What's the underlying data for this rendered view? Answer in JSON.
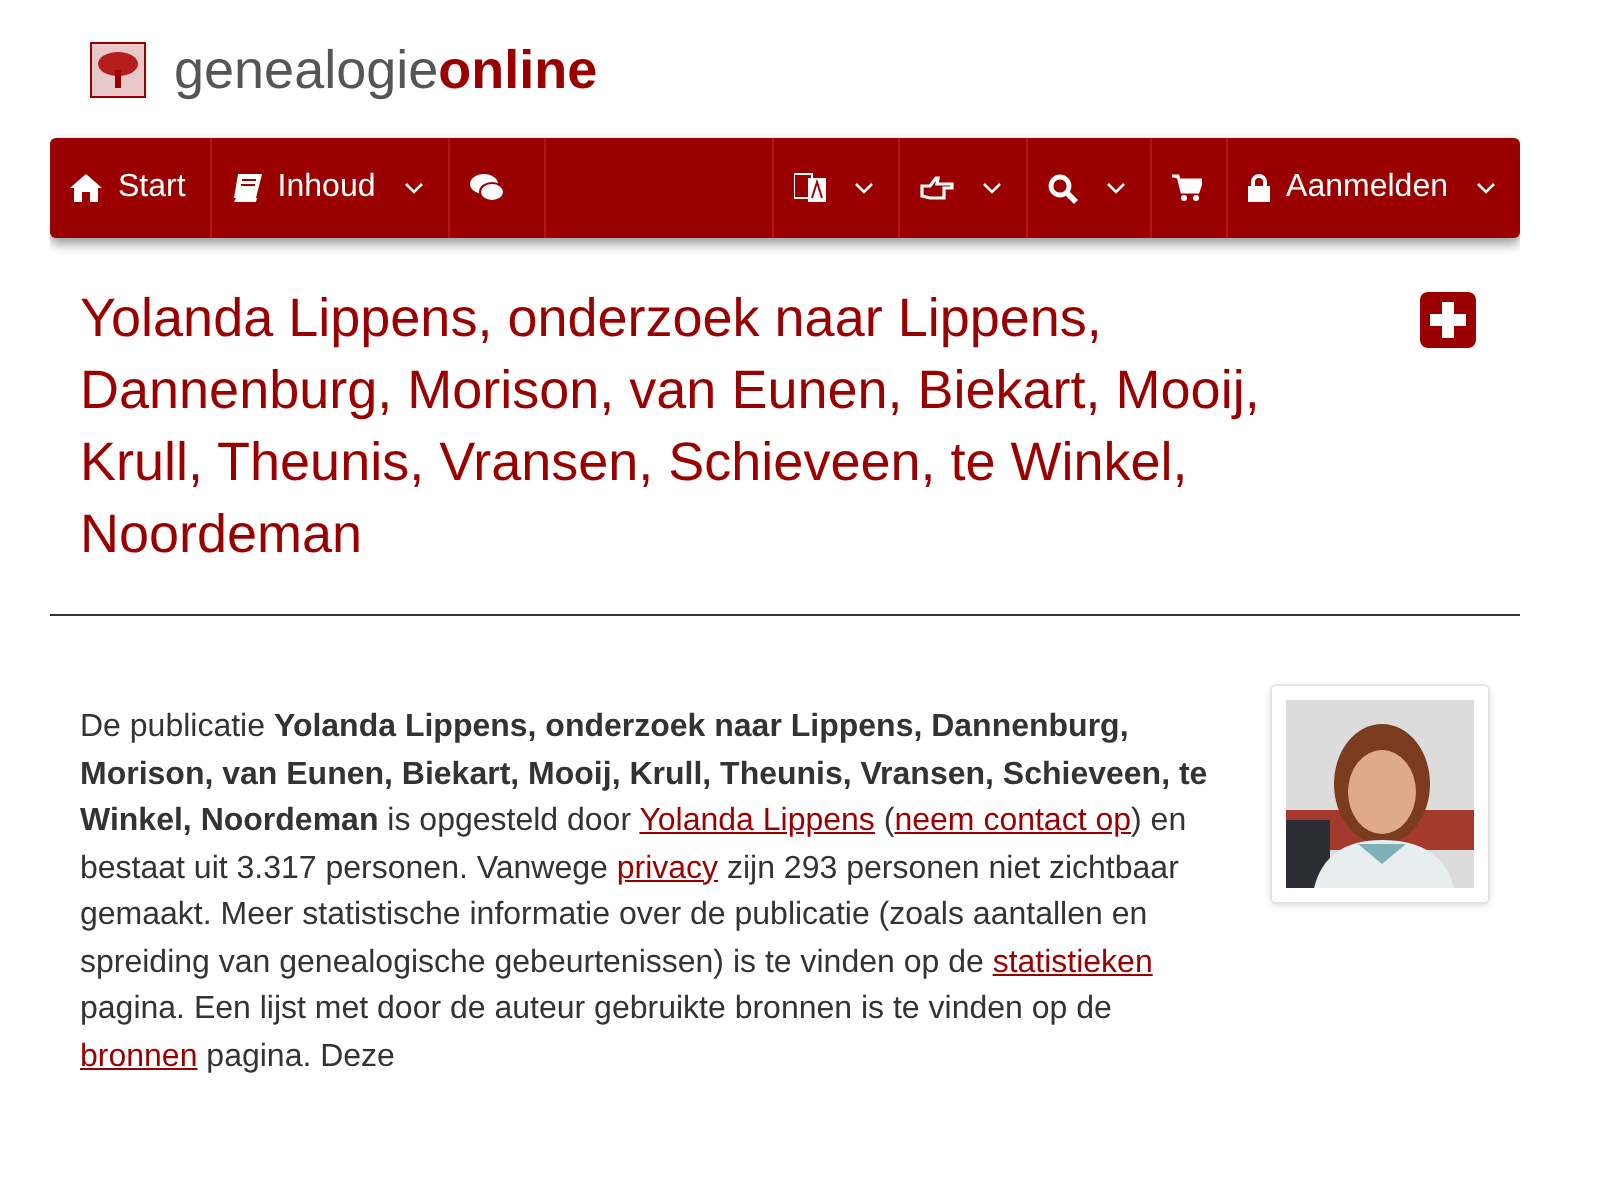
{
  "logo": {
    "name_part": "genealogie",
    "accent_part": "online"
  },
  "nav": {
    "left_items": [
      {
        "label": "Start",
        "dropdown": false
      },
      {
        "label": "Inhoud",
        "dropdown": true
      },
      {
        "dropdown": false
      }
    ],
    "right_items": [
      {
        "dropdown": true
      },
      {
        "dropdown": true
      },
      {
        "dropdown": true
      },
      {
        "dropdown": false
      },
      {
        "label": "Aanmelden",
        "dropdown": true
      }
    ]
  },
  "title": "Yolanda Lippens, onderzoek naar Lippens, Dannenburg, Morison, van Eunen, Biekart, Mooij, Krull, Theunis, Vransen, Schieveen, te Winkel, Noordeman",
  "intro": {
    "segments": [
      {
        "kind": "text",
        "text": "De publicatie **Yolanda Lippens, onderzoek naar Lippens, Dannenburg, Morison, van Eunen, Biekart, Mooij, Krull, Theunis, Vransen, Schieveen, te Winkel, Noordeman** is opgesteld door "
      },
      {
        "kind": "link",
        "text": "Yolanda Lippens"
      },
      {
        "kind": "text",
        "text": " ("
      },
      {
        "kind": "link",
        "text": "neem contact op"
      },
      {
        "kind": "text",
        "text": ") en bestaat uit 3.317 personen. Vanwege "
      },
      {
        "kind": "link",
        "text": "privacy"
      },
      {
        "kind": "text",
        "text": " zijn 293 personen niet zichtbaar gemaakt. Meer statistische informatie over de publicatie (zoals aantallen en spreiding van genealogische gebeurtenissen) is te vinden op de "
      },
      {
        "kind": "link",
        "text": "statistieken"
      },
      {
        "kind": "text",
        "text": " pagina. Een lijst met door de auteur gebruikte bronnen is te vinden op de "
      },
      {
        "kind": "link",
        "text": "bronnen"
      },
      {
        "kind": "text",
        "text": " pagina. Deze"
      }
    ]
  }
}
